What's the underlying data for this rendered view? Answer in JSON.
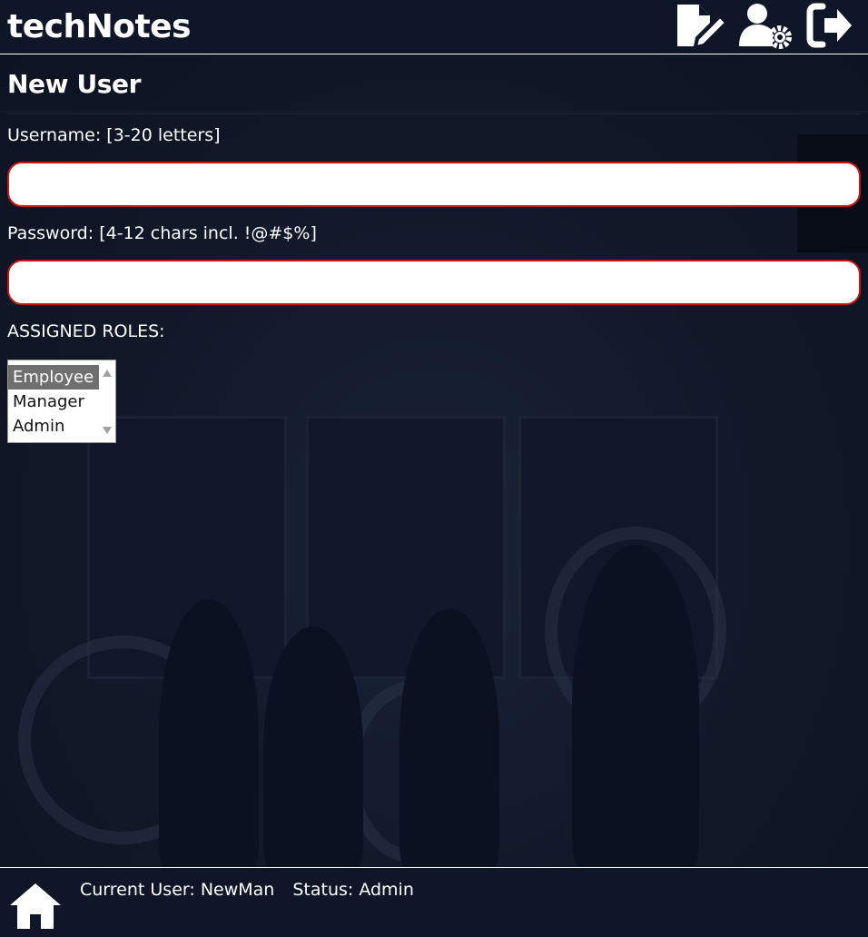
{
  "header": {
    "title": "techNotes",
    "actions": [
      {
        "icon": "note-edit-icon"
      },
      {
        "icon": "user-settings-icon"
      },
      {
        "icon": "logout-icon"
      }
    ]
  },
  "form": {
    "title": "New User",
    "username": {
      "label": "Username: [3-20 letters]",
      "value": "",
      "placeholder": ""
    },
    "password": {
      "label": "Password: [4-12 chars incl. !@#$%]",
      "value": "",
      "placeholder": ""
    },
    "roles": {
      "label": "ASSIGNED ROLES:",
      "options": [
        "Employee",
        "Manager",
        "Admin"
      ],
      "selected": "Employee"
    }
  },
  "footer": {
    "home_icon": "home-icon",
    "current_user": "Current User: NewMan",
    "status": "Status: Admin"
  },
  "colors": {
    "background": "#0f1628",
    "input_border_invalid": "#cc1414",
    "text": "#ffffff"
  }
}
